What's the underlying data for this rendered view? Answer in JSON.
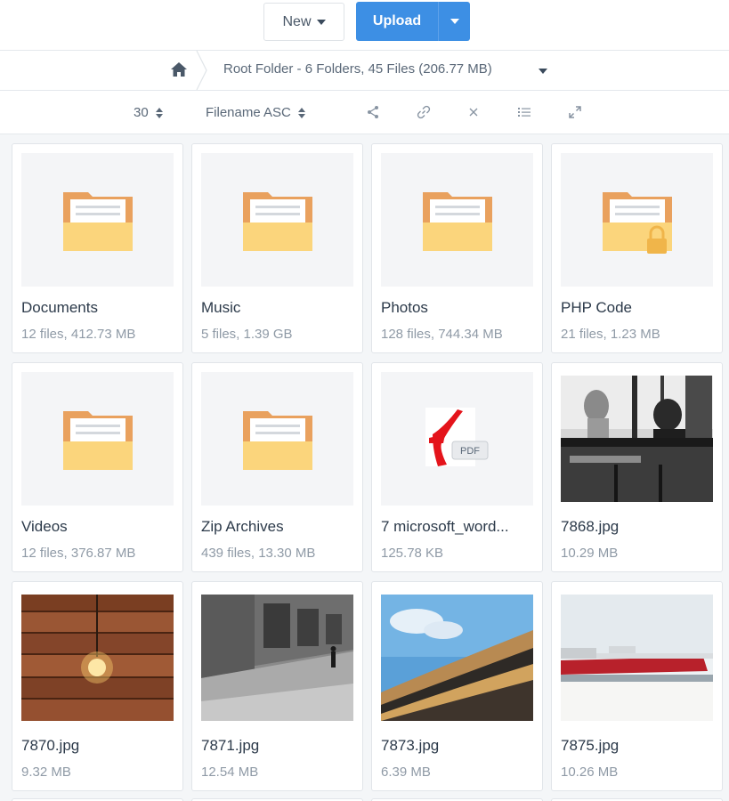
{
  "toolbar_top": {
    "new_label": "New",
    "upload_label": "Upload"
  },
  "breadcrumb": {
    "text": "Root Folder - 6 Folders, 45 Files (206.77 MB)"
  },
  "controls": {
    "per_page": "30",
    "sort": "Filename ASC",
    "icons": [
      "share-icon",
      "link-icon",
      "close-icon",
      "list-view-icon",
      "expand-icon"
    ]
  },
  "items": [
    {
      "name": "Documents",
      "meta": "12 files, 412.73 MB",
      "kind": "folder"
    },
    {
      "name": "Music",
      "meta": "5 files, 1.39 GB",
      "kind": "folder"
    },
    {
      "name": "Photos",
      "meta": "128 files, 744.34 MB",
      "kind": "folder"
    },
    {
      "name": "PHP Code",
      "meta": "21 files, 1.23 MB",
      "kind": "folder-locked"
    },
    {
      "name": "Videos",
      "meta": "12 files, 376.87 MB",
      "kind": "folder"
    },
    {
      "name": "Zip Archives",
      "meta": "439 files, 13.30 MB",
      "kind": "folder"
    },
    {
      "name": "7 microsoft_word...",
      "meta": "125.78 KB",
      "kind": "pdf",
      "badge": "PDF"
    },
    {
      "name": "7868.jpg",
      "meta": "10.29 MB",
      "kind": "photo-cafe"
    },
    {
      "name": "7870.jpg",
      "meta": "9.32 MB",
      "kind": "photo-wood"
    },
    {
      "name": "7871.jpg",
      "meta": "12.54 MB",
      "kind": "photo-street"
    },
    {
      "name": "7873.jpg",
      "meta": "6.39 MB",
      "kind": "photo-arena"
    },
    {
      "name": "7875.jpg",
      "meta": "10.26 MB",
      "kind": "photo-ship"
    }
  ],
  "colors": {
    "accent": "#3d8fe4",
    "folder_front": "#fbd57c",
    "folder_back": "#e9a15e"
  }
}
